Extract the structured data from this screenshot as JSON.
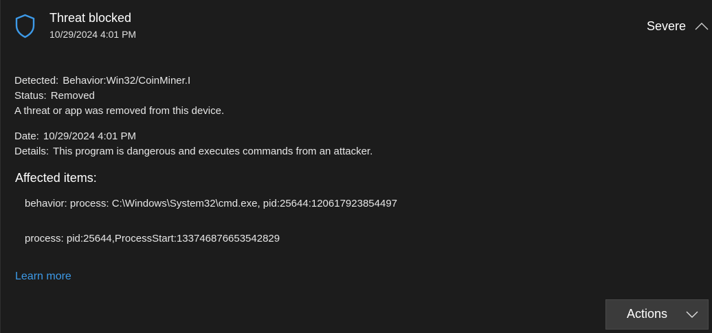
{
  "header": {
    "title": "Threat blocked",
    "timestamp": "10/29/2024 4:01 PM",
    "severity": "Severe",
    "icon": "shield-icon",
    "accent_color": "#3d9ae8"
  },
  "details": {
    "detected_label": "Detected:",
    "detected_value": "Behavior:Win32/CoinMiner.I",
    "status_label": "Status:",
    "status_value": "Removed",
    "status_message": "A threat or app was removed from this device.",
    "date_label": "Date:",
    "date_value": "10/29/2024 4:01 PM",
    "details_label": "Details:",
    "details_value": "This program is dangerous and executes commands from an attacker."
  },
  "affected": {
    "heading": "Affected items:",
    "items": [
      "behavior: process: C:\\Windows\\System32\\cmd.exe, pid:25644:120617923854497",
      "process: pid:25644,ProcessStart:133746876653542829"
    ]
  },
  "links": {
    "learn_more": "Learn more"
  },
  "actions": {
    "label": "Actions"
  }
}
